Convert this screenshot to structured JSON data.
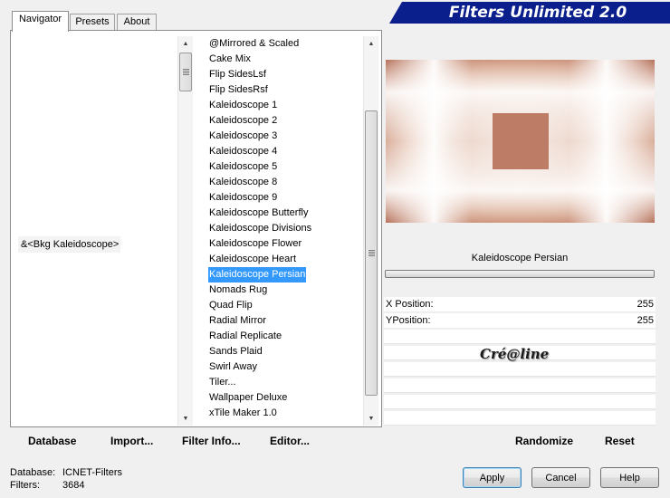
{
  "title": "Filters Unlimited 2.0",
  "tabs": [
    "Navigator",
    "Presets",
    "About"
  ],
  "navigator": {
    "selected_category": "&<Bkg Kaleidoscope>"
  },
  "filters": [
    "@Mirrored & Scaled",
    "Cake Mix",
    "Flip SidesLsf",
    "Flip SidesRsf",
    "Kaleidoscope 1",
    "Kaleidoscope 2",
    "Kaleidoscope 3",
    "Kaleidoscope 4",
    "Kaleidoscope 5",
    "Kaleidoscope 8",
    "Kaleidoscope 9",
    "Kaleidoscope Butterfly",
    "Kaleidoscope Divisions",
    "Kaleidoscope Flower",
    "Kaleidoscope Heart",
    "Kaleidoscope Persian",
    "Nomads Rug",
    "Quad Flip",
    "Radial Mirror",
    "Radial Replicate",
    "Sands Plaid",
    "Swirl Away",
    "Tiler...",
    "Wallpaper Deluxe",
    "xTile Maker 1.0"
  ],
  "selected_filter": "Kaleidoscope Persian",
  "params": [
    {
      "label": "X Position:",
      "value": "255"
    },
    {
      "label": "YPosition:",
      "value": "255"
    }
  ],
  "signature": "Cré@line",
  "commands": {
    "database": "Database",
    "import": "Import...",
    "filter_info": "Filter Info...",
    "editor": "Editor...",
    "randomize": "Randomize",
    "reset": "Reset"
  },
  "footer": {
    "database_label": "Database:",
    "database_value": "ICNET-Filters",
    "filters_label": "Filters:",
    "filters_value": "3684"
  },
  "buttons": {
    "apply": "Apply",
    "cancel": "Cancel",
    "help": "Help"
  },
  "colors": {
    "banner": "#0a1e8c",
    "selection": "#3399ff",
    "preview_tone": "#b87058"
  }
}
